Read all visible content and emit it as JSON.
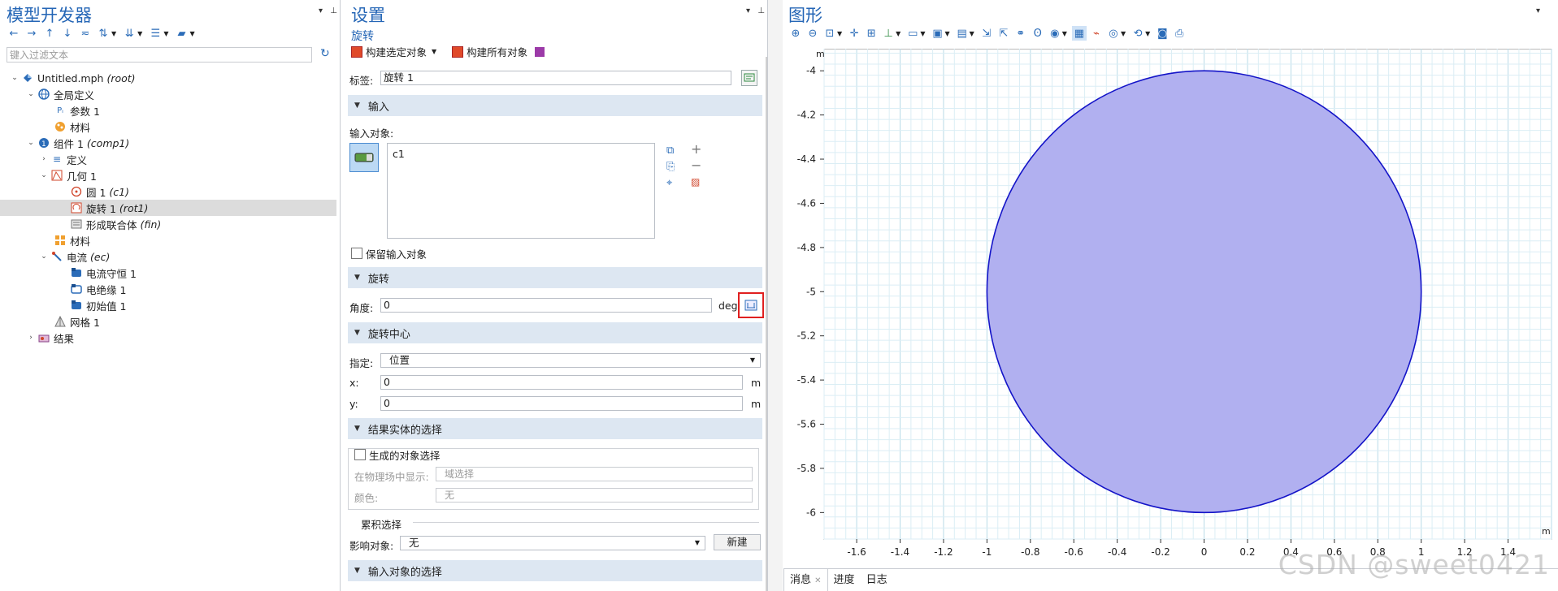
{
  "left": {
    "title": "模型开发器",
    "filter_placeholder": "键入过滤文本",
    "tree": [
      {
        "label": "Untitled.mph",
        "tag": "(root)"
      },
      {
        "label": "全局定义",
        "tag": ""
      },
      {
        "label": "参数 1",
        "tag": ""
      },
      {
        "label": "材料",
        "tag": ""
      },
      {
        "label": "组件 1",
        "tag": "(comp1)"
      },
      {
        "label": "定义",
        "tag": ""
      },
      {
        "label": "几何 1",
        "tag": ""
      },
      {
        "label": "圆 1",
        "tag": "(c1)"
      },
      {
        "label": "旋转 1",
        "tag": "(rot1)"
      },
      {
        "label": "形成联合体",
        "tag": "(fin)"
      },
      {
        "label": "材料",
        "tag": ""
      },
      {
        "label": "电流",
        "tag": "(ec)"
      },
      {
        "label": "电流守恒 1",
        "tag": ""
      },
      {
        "label": "电绝缘 1",
        "tag": ""
      },
      {
        "label": "初始值 1",
        "tag": ""
      },
      {
        "label": "网格 1",
        "tag": ""
      },
      {
        "label": "结果",
        "tag": ""
      }
    ]
  },
  "mid": {
    "title": "设置",
    "subtitle": "旋转",
    "build_selected": "构建选定对象",
    "build_all": "构建所有对象",
    "label_caption": "标签:",
    "label_value": "旋转 1",
    "sec_input": "输入",
    "input_objects_caption": "输入对象:",
    "input_object_item": "c1",
    "keep_input": "保留输入对象",
    "sec_rotation": "旋转",
    "angle_caption": "角度:",
    "angle_value": "0",
    "angle_unit": "deg",
    "sec_center": "旋转中心",
    "specify_caption": "指定:",
    "specify_value": "位置",
    "x_caption": "x:",
    "x_value": "0",
    "y_caption": "y:",
    "y_value": "0",
    "len_unit": "m",
    "sec_result_sel": "结果实体的选择",
    "gen_obj_sel": "生成的对象选择",
    "show_in_physics_caption": "在物理场中显示:",
    "show_in_physics_value": "域选择",
    "color_caption": "颜色:",
    "color_value": "无",
    "cumulative_sel": "累积选择",
    "contribute_caption": "影响对象:",
    "contribute_value": "无",
    "new_button": "新建",
    "sec_input_sel": "输入对象的选择"
  },
  "right": {
    "title": "图形",
    "tabs": [
      "消息",
      "进度",
      "日志"
    ],
    "watermark": "CSDN @sweet0421"
  },
  "chart_data": {
    "type": "scatter",
    "title": "",
    "xlabel": "m",
    "ylabel": "m",
    "xlim": [
      -1.75,
      1.6
    ],
    "ylim": [
      -6.12,
      -3.9
    ],
    "xticks": [
      -1.6,
      -1.4,
      -1.2,
      -1,
      -0.8,
      -0.6,
      -0.4,
      -0.2,
      0,
      0.2,
      0.4,
      0.6,
      0.8,
      1,
      1.2,
      1.4
    ],
    "yticks": [
      -4,
      -4.2,
      -4.4,
      -4.6,
      -4.8,
      -5,
      -5.2,
      -5.4,
      -5.6,
      -5.8,
      -6
    ],
    "shape": {
      "kind": "circle",
      "center": [
        0,
        -5
      ],
      "radius": 1
    },
    "fill_color": "#b1b0f0",
    "edge_color": "#1414c8",
    "grid": true
  }
}
